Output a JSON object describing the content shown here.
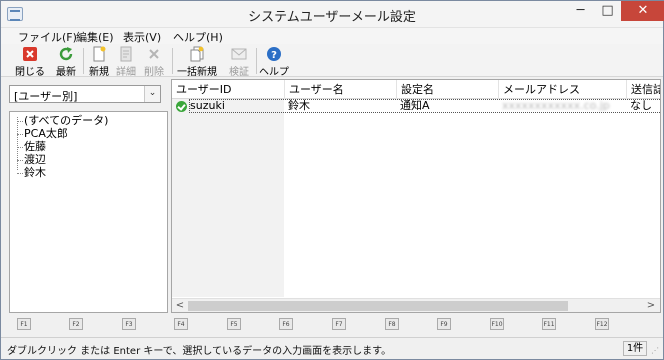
{
  "window": {
    "title": "システムユーザーメール設定"
  },
  "titlebar": {
    "min_glyph": "─",
    "max_glyph": "□",
    "close_glyph": "✕"
  },
  "menu": [
    {
      "label": "ファイル(F)"
    },
    {
      "label": "編集(E)"
    },
    {
      "label": "表示(V)"
    },
    {
      "label": "ヘルプ(H)"
    }
  ],
  "toolbar": {
    "close": {
      "label": "閉じる",
      "icon": "close-x-icon",
      "color": "#d9392c"
    },
    "refresh": {
      "label": "最新",
      "icon": "refresh-icon",
      "color": "#3b9b3b"
    },
    "new": {
      "label": "新規",
      "icon": "new-doc-icon"
    },
    "detail": {
      "label": "詳細",
      "icon": "detail-doc-icon",
      "disabled": true
    },
    "delete": {
      "label": "削除",
      "icon": "delete-x-icon",
      "disabled": true
    },
    "bulk_new": {
      "label": "一括新規",
      "icon": "bulk-new-icon"
    },
    "verify": {
      "label": "検証",
      "icon": "envelope-icon",
      "disabled": true
    },
    "help": {
      "label": "ヘルプ",
      "icon": "help-icon",
      "color": "#2c6fc6"
    }
  },
  "filter": {
    "selected": "[ユーザー別]",
    "arrow": "⌄"
  },
  "tree": {
    "items": [
      {
        "label": "(すべてのデータ)"
      },
      {
        "label": "PCA太郎"
      },
      {
        "label": "佐藤"
      },
      {
        "label": "渡辺"
      },
      {
        "label": "鈴木"
      }
    ]
  },
  "grid": {
    "columns": [
      {
        "label": "ユーザーID"
      },
      {
        "label": "ユーザー名"
      },
      {
        "label": "設定名"
      },
      {
        "label": "メールアドレス"
      },
      {
        "label": "送信誌"
      }
    ],
    "rows": [
      {
        "user_id": "suzuki",
        "user_name": "鈴木",
        "setting": "通知A",
        "email": "xxxxxxxxxxxx.co.jp",
        "send": "なし"
      }
    ],
    "scroll_left": "<",
    "scroll_right": ">"
  },
  "fkeys": [
    "F1",
    "F2",
    "F3",
    "F4",
    "F5",
    "F6",
    "F7",
    "F8",
    "F9",
    "F10",
    "F11",
    "F12"
  ],
  "status": {
    "message": "ダブルクリック または Enter キーで、選択しているデータの入力画面を表示します。",
    "count": "1件",
    "grip": "⋰"
  }
}
